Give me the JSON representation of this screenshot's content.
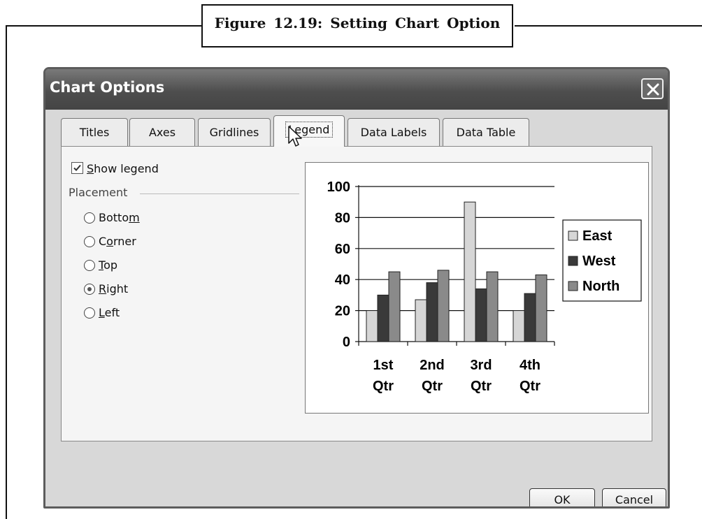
{
  "figure": {
    "caption": "Figure 12.19: Setting Chart Option"
  },
  "dialog": {
    "title": "Chart Options",
    "tabs": [
      {
        "label": "Titles"
      },
      {
        "label": "Axes"
      },
      {
        "label": "Gridlines"
      },
      {
        "label": "Legend",
        "active": true
      },
      {
        "label": "Data Labels"
      },
      {
        "label": "Data Table"
      }
    ],
    "show_legend": {
      "label": "Show legend",
      "checked": true
    },
    "placement": {
      "label": "Placement",
      "options": [
        {
          "label": "Bottom",
          "selected": false
        },
        {
          "label": "Corner",
          "selected": false
        },
        {
          "label": "Top",
          "selected": false
        },
        {
          "label": "Right",
          "selected": true
        },
        {
          "label": "Left",
          "selected": false
        }
      ]
    },
    "buttons": {
      "ok": "OK",
      "cancel": "Cancel"
    }
  },
  "chart_data": {
    "type": "bar",
    "categories": [
      [
        "1st",
        "Qtr"
      ],
      [
        "2nd",
        "Qtr"
      ],
      [
        "3rd",
        "Qtr"
      ],
      [
        "4th",
        "Qtr"
      ]
    ],
    "series": [
      {
        "name": "East",
        "values": [
          20,
          27,
          90,
          20
        ],
        "color": "#d6d6d6"
      },
      {
        "name": "West",
        "values": [
          30,
          38,
          34,
          31
        ],
        "color": "#3a3a3a"
      },
      {
        "name": "North",
        "values": [
          45,
          46,
          45,
          43
        ],
        "color": "#8a8a8a"
      }
    ],
    "yticks": [
      0,
      20,
      40,
      60,
      80,
      100
    ],
    "ylim": [
      0,
      100
    ],
    "grid": true,
    "legend_position": "right"
  }
}
